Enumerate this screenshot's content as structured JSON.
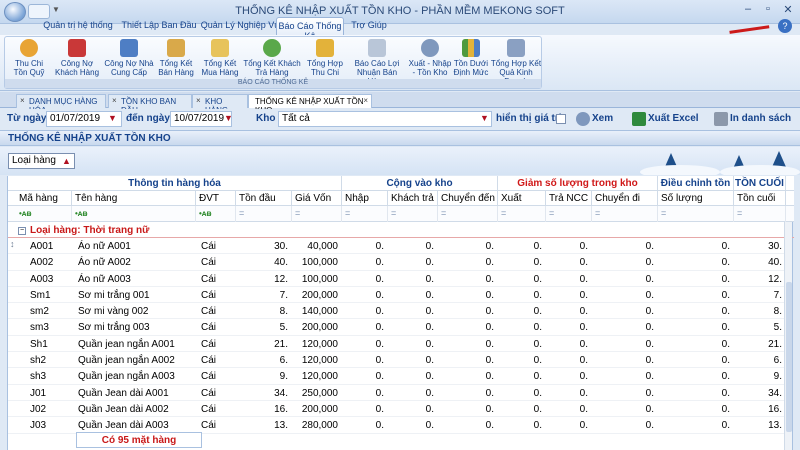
{
  "window": {
    "title": "THỐNG KÊ NHẬP XUẤT TỒN KHO - PHẦN MỀM MEKONG SOFT"
  },
  "ribbon_tabs": [
    "Quản trị hệ thống",
    "Thiết Lập Ban Đầu",
    "Quản Lý Nghiệp Vụ",
    "Báo Cáo Thống Kê",
    "Trợ Giúp"
  ],
  "ribbon": {
    "group_label": "BÁO CÁO THỐNG KÊ",
    "buttons": [
      {
        "line1": "Thu Chi",
        "line2": "Tồn Quỹ"
      },
      {
        "line1": "Công Nợ",
        "line2": "Khách Hàng"
      },
      {
        "line1": "Công Nợ Nhà",
        "line2": "Cung Cấp"
      },
      {
        "line1": "Tổng Kết",
        "line2": "Bán Hàng"
      },
      {
        "line1": "Tổng Kết",
        "line2": "Mua Hàng"
      },
      {
        "line1": "Tổng Kết Khách",
        "line2": "Trả Hàng"
      },
      {
        "line1": "Tổng Hợp",
        "line2": "Thu Chi"
      },
      {
        "line1": "Báo Cáo Lợi",
        "line2": "Nhuận Bán Hàng"
      },
      {
        "line1": "Xuất - Nhập",
        "line2": "- Tồn Kho"
      },
      {
        "line1": "Tồn Dưới",
        "line2": "Định Mức"
      },
      {
        "line1": "Tổng Hợp Kết",
        "line2": "Quả Kinh Doanh"
      }
    ]
  },
  "doc_tabs": [
    "DANH MỤC HÀNG HÓA",
    "TỒN KHO BAN ĐẦU",
    "KHO HÀNG",
    "THỐNG KÊ NHẬP XUẤT TỒN KHO"
  ],
  "filter": {
    "from_label": "Từ ngày",
    "from_value": "01/07/2019",
    "to_label": "đến ngày",
    "to_value": "10/07/2019",
    "kho_label": "Kho",
    "kho_value": "Tất cả",
    "show_value_label": "hiển thị giá trị",
    "view_label": "Xem",
    "excel_label": "Xuất Excel",
    "print_label": "In danh sách"
  },
  "section_title": "THỐNG KÊ NHẬP XUẤT TỒN KHO",
  "group_chip": "Loại hàng",
  "grid": {
    "bands": {
      "info": "Thông tin hàng hóa",
      "import": "Cộng vào kho",
      "export": "Giảm số lượng trong kho",
      "adjust": "Điều chỉnh tồn",
      "end": "TỒN CUỐI"
    },
    "columns": [
      "Mã hàng",
      "Tên hàng",
      "ĐVT",
      "Tồn đầu",
      "Giá Vốn",
      "Nhập",
      "Khách trả",
      "Chuyển đến",
      "Xuất",
      "Trả NCC",
      "Chuyển đi",
      "Số lượng",
      "Tồn cuối"
    ],
    "group_row": "Loại hàng: Thời trang nữ",
    "rows": [
      {
        "ma": "A001",
        "ten": "Áo nữ A001",
        "dvt": "Cái",
        "tondau": "30.",
        "giavon": "40,000",
        "toncuoi": "30."
      },
      {
        "ma": "A002",
        "ten": "Áo nữ A002",
        "dvt": "Cái",
        "tondau": "40.",
        "giavon": "100,000",
        "toncuoi": "40."
      },
      {
        "ma": "A003",
        "ten": "Áo nữ A003",
        "dvt": "Cái",
        "tondau": "12.",
        "giavon": "100,000",
        "toncuoi": "12."
      },
      {
        "ma": "Sm1",
        "ten": "Sơ mi trắng 001",
        "dvt": "Cái",
        "tondau": "7.",
        "giavon": "200,000",
        "toncuoi": "7."
      },
      {
        "ma": "sm2",
        "ten": "Sơ mi vàng 002",
        "dvt": "Cái",
        "tondau": "8.",
        "giavon": "140,000",
        "toncuoi": "8."
      },
      {
        "ma": "sm3",
        "ten": "Sơ mi trắng 003",
        "dvt": "Cái",
        "tondau": "5.",
        "giavon": "200,000",
        "toncuoi": "5."
      },
      {
        "ma": "Sh1",
        "ten": "Quần jean ngắn A001",
        "dvt": "Cái",
        "tondau": "21.",
        "giavon": "120,000",
        "toncuoi": "21."
      },
      {
        "ma": "sh2",
        "ten": "Quần jean ngắn A002",
        "dvt": "Cái",
        "tondau": "6.",
        "giavon": "120,000",
        "toncuoi": "6."
      },
      {
        "ma": "sh3",
        "ten": "Quần jean ngắn A003",
        "dvt": "Cái",
        "tondau": "9.",
        "giavon": "120,000",
        "toncuoi": "9."
      },
      {
        "ma": "J01",
        "ten": "Quần Jean dài A001",
        "dvt": "Cái",
        "tondau": "34.",
        "giavon": "250,000",
        "toncuoi": "34."
      },
      {
        "ma": "J02",
        "ten": "Quần Jean dài A002",
        "dvt": "Cái",
        "tondau": "16.",
        "giavon": "200,000",
        "toncuoi": "16."
      },
      {
        "ma": "J03",
        "ten": "Quần Jean dài A003",
        "dvt": "Cái",
        "tondau": "13.",
        "giavon": "280,000",
        "toncuoi": "13."
      }
    ],
    "zero": "0.",
    "footer": "Có 95 mặt hàng"
  },
  "colors": {
    "accent": "#15428b",
    "group_red": "#c81818"
  }
}
